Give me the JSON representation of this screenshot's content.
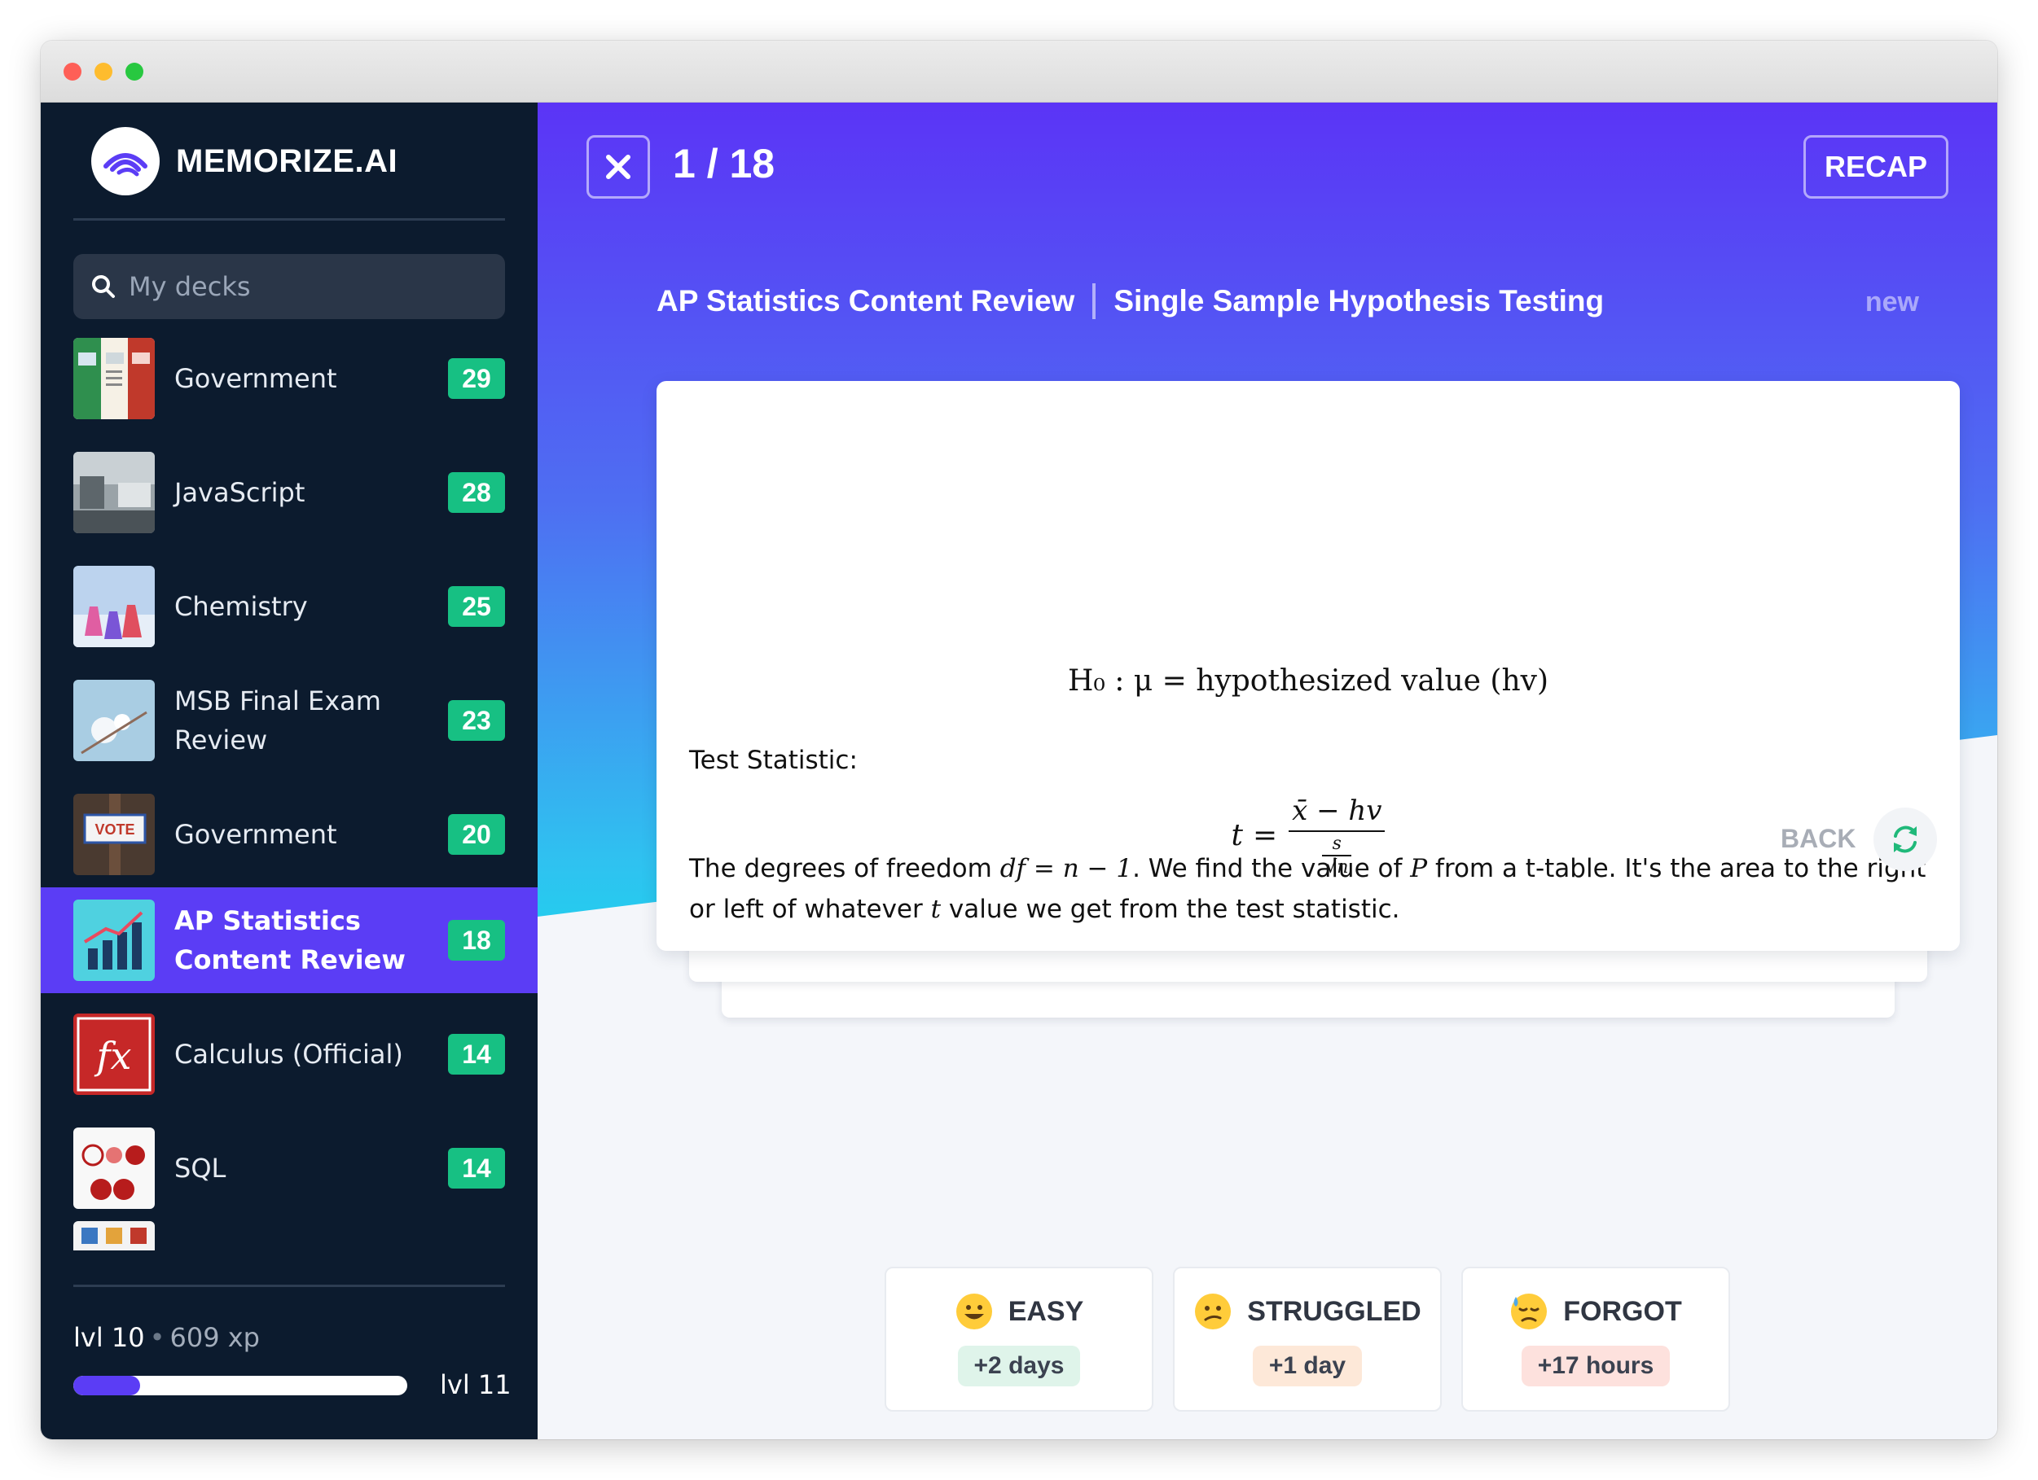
{
  "app": {
    "brand_name": "MEMORIZE.AI"
  },
  "sidebar": {
    "search": {
      "placeholder": "My decks"
    },
    "decks": [
      {
        "name": "Government",
        "count": "29",
        "thumb": "government-posters"
      },
      {
        "name": "JavaScript",
        "count": "28",
        "thumb": "street-photo"
      },
      {
        "name": "Chemistry",
        "count": "25",
        "thumb": "lab-flasks"
      },
      {
        "name": "MSB Final Exam Review",
        "count": "23",
        "thumb": "blossom"
      },
      {
        "name": "Government",
        "count": "20",
        "thumb": "vote-sign"
      },
      {
        "name": "AP Statistics Content Review",
        "count": "18",
        "thumb": "bar-chart",
        "active": true
      },
      {
        "name": "Calculus (Official)",
        "count": "14",
        "thumb": "fx-logo"
      },
      {
        "name": "SQL",
        "count": "14",
        "thumb": "sql-joins"
      }
    ],
    "level": {
      "current": "lvl 10",
      "xp": "609 xp",
      "next": "lvl 11",
      "progress": 0.2
    }
  },
  "session": {
    "counter": "1 / 18",
    "recap_label": "RECAP",
    "deck_title": "AP Statistics Content Review",
    "topic_title": "Single Sample Hypothesis Testing",
    "card_state": "new"
  },
  "card": {
    "h0_formula": "H₀ : μ = hypothesized value (hv)",
    "test_stat_label": "Test Statistic:",
    "t_var": "t",
    "numerator": "x̄ − hv",
    "den_top": "s",
    "den_bottom": "√n",
    "para_1": "The degrees of freedom ",
    "para_df": "df = n − 1",
    "para_2": ". We find the value of ",
    "para_p": "P",
    "para_3": " from a t-table. It's the area to the right or left of whatever ",
    "para_t": "t",
    "para_4": " value we get from the test statistic.",
    "back_label": "BACK"
  },
  "answers": [
    {
      "label": "EASY",
      "interval": "+2 days",
      "emoji": "grinning-face",
      "color": "#dff4ea"
    },
    {
      "label": "STRUGGLED",
      "interval": "+1 day",
      "emoji": "confused-face",
      "color": "#fde8d8"
    },
    {
      "label": "FORGOT",
      "interval": "+17 hours",
      "emoji": "downcast-sweat-face",
      "color": "#fde1dd"
    }
  ],
  "colors": {
    "accent": "#5b3df5",
    "sidebar_bg": "#0c1b2e",
    "badge": "#17c083"
  }
}
